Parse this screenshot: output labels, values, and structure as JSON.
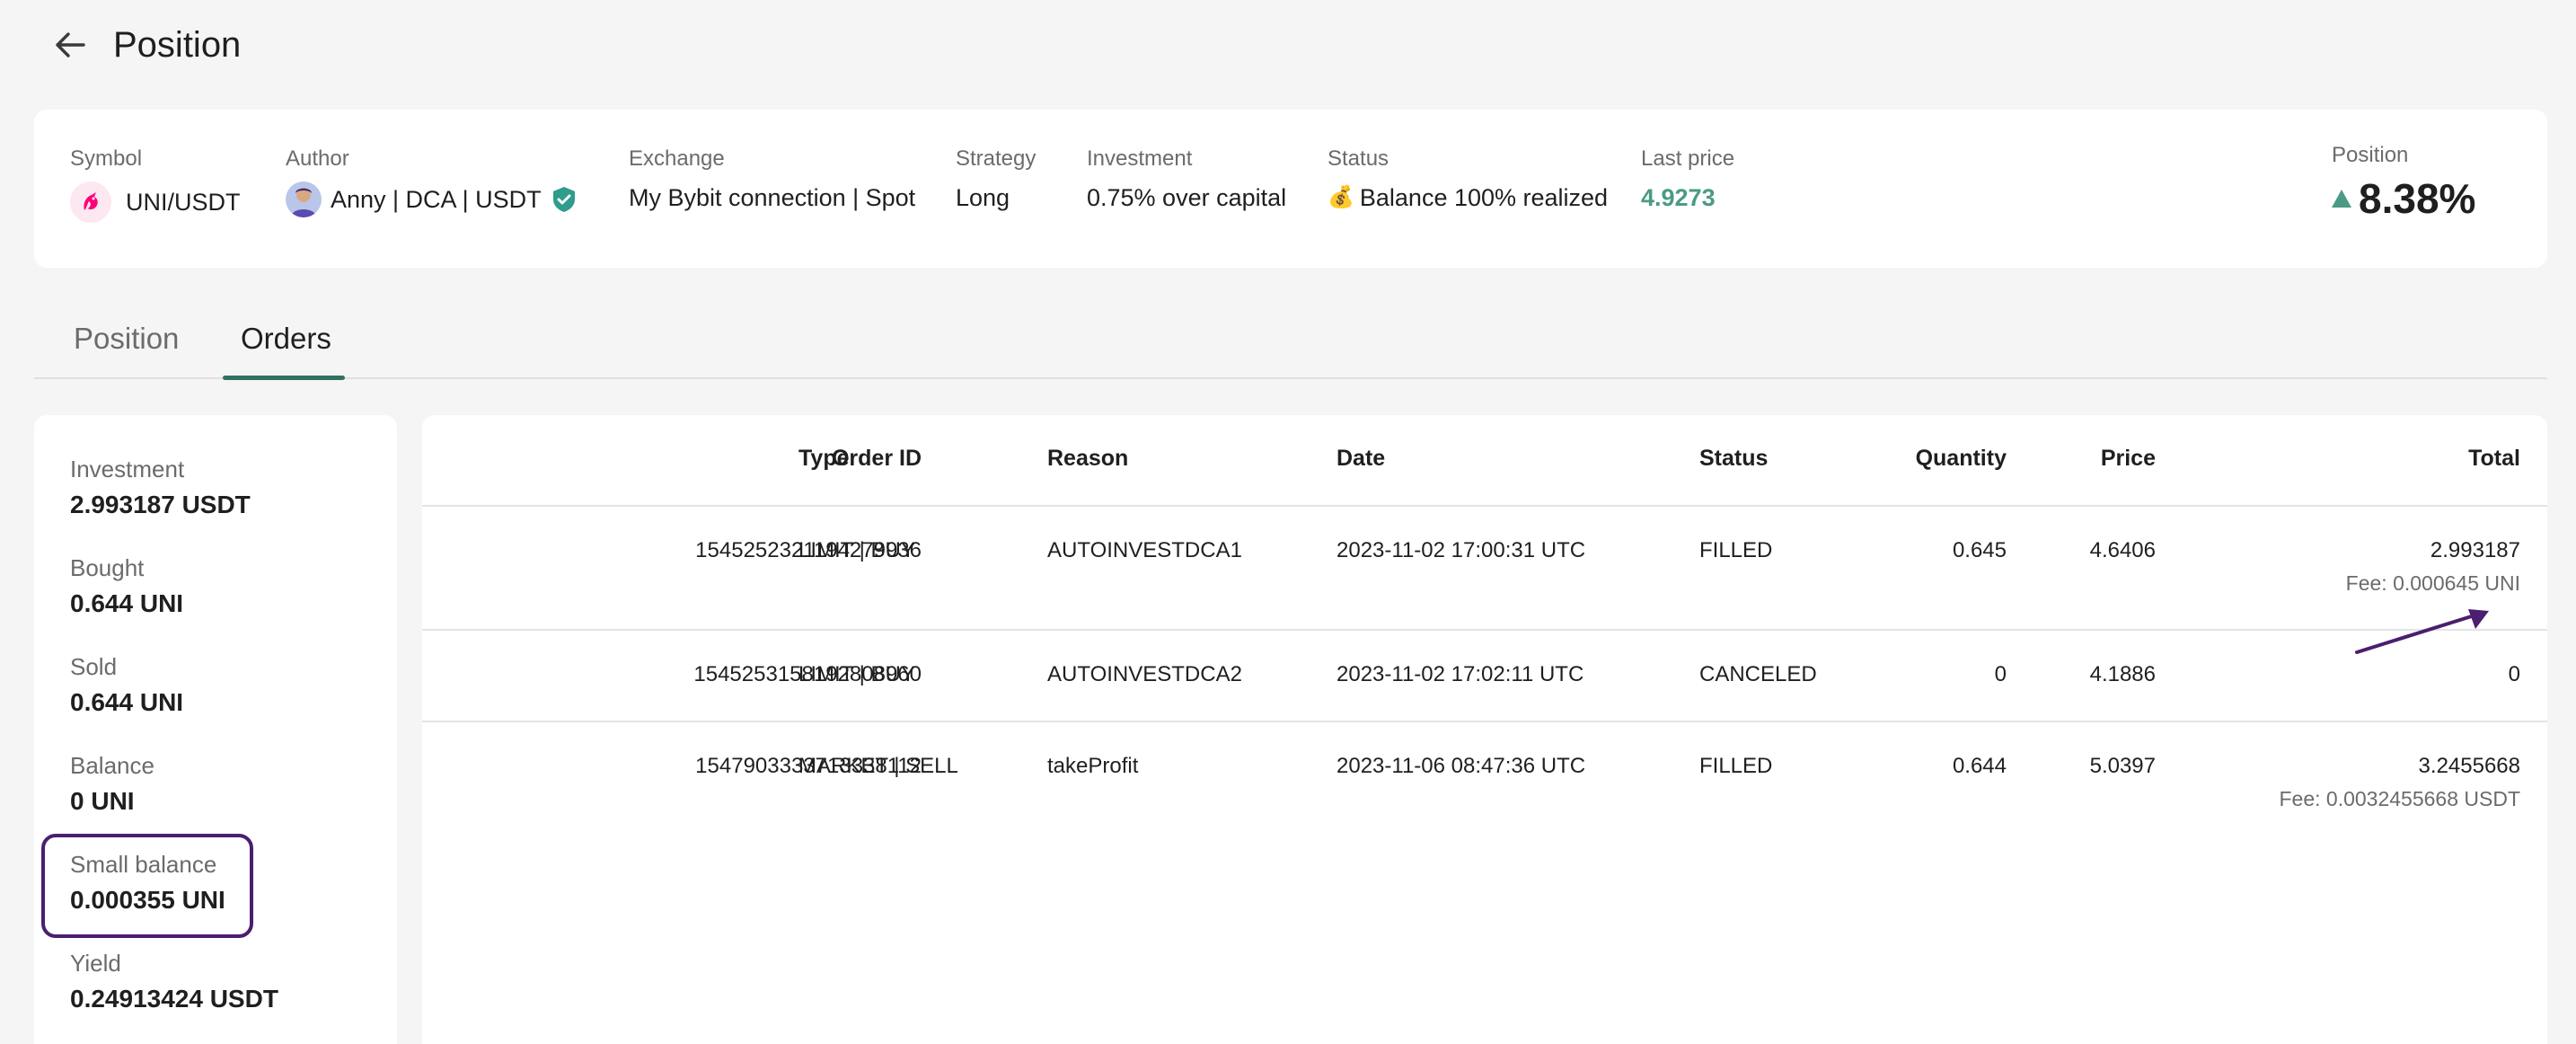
{
  "page": {
    "title": "Position"
  },
  "summary": {
    "symbol": {
      "label": "Symbol",
      "value": "UNI/USDT",
      "icon": "uniswap-unicorn-icon"
    },
    "author": {
      "label": "Author",
      "value": "Anny | DCA | USDT",
      "icon": "verified-shield-icon"
    },
    "exchange": {
      "label": "Exchange",
      "value": "My Bybit connection | Spot"
    },
    "strategy": {
      "label": "Strategy",
      "value": "Long"
    },
    "investment": {
      "label": "Investment",
      "value": "0.75% over capital"
    },
    "status": {
      "label": "Status",
      "value": "Balance 100% realized",
      "icon": "money-bag-emoji"
    },
    "last_price": {
      "label": "Last price",
      "value": "4.9273",
      "color": "#4a9a85"
    },
    "position": {
      "label": "Position",
      "value": "8.38%",
      "trend": "up"
    }
  },
  "tabs": [
    {
      "label": "Position",
      "active": false
    },
    {
      "label": "Orders",
      "active": true
    }
  ],
  "stats": [
    {
      "label": "Investment",
      "value": "2.993187 USDT"
    },
    {
      "label": "Bought",
      "value": "0.644 UNI"
    },
    {
      "label": "Sold",
      "value": "0.644 UNI"
    },
    {
      "label": "Balance",
      "value": "0 UNI"
    },
    {
      "label": "Small balance",
      "value": "0.000355 UNI",
      "highlighted": true
    },
    {
      "label": "Yield",
      "value": "0.24913424 USDT"
    }
  ],
  "orders": {
    "columns": [
      "Order ID",
      "Type",
      "Reason",
      "Date",
      "Status",
      "Quantity",
      "Price",
      "Total"
    ],
    "rows": [
      {
        "order_id": "1545252321194279936",
        "type": "LIMIT | BUY",
        "reason": "AUTOINVESTDCA1",
        "date": "2023-11-02 17:00:31 UTC",
        "status": "FILLED",
        "quantity": "0.645",
        "price": "4.6406",
        "total": "2.993187",
        "fee": "Fee: 0.000645 UNI"
      },
      {
        "order_id": "1545253158192808960",
        "type": "LIMIT | BUY",
        "reason": "AUTOINVESTDCA2",
        "date": "2023-11-02 17:02:11 UTC",
        "status": "CANCELED",
        "quantity": "0",
        "price": "4.1886",
        "total": "0",
        "fee": ""
      },
      {
        "order_id": "1547903333713338112",
        "type": "MARKET | SELL",
        "reason": "takeProfit",
        "date": "2023-11-06 08:47:36 UTC",
        "status": "FILLED",
        "quantity": "0.644",
        "price": "5.0397",
        "total": "3.2455668",
        "fee": "Fee: 0.0032455668 USDT"
      }
    ]
  },
  "colors": {
    "accent": "#2e7263",
    "positive": "#4a9a85",
    "annotation": "#4b1e6f"
  }
}
